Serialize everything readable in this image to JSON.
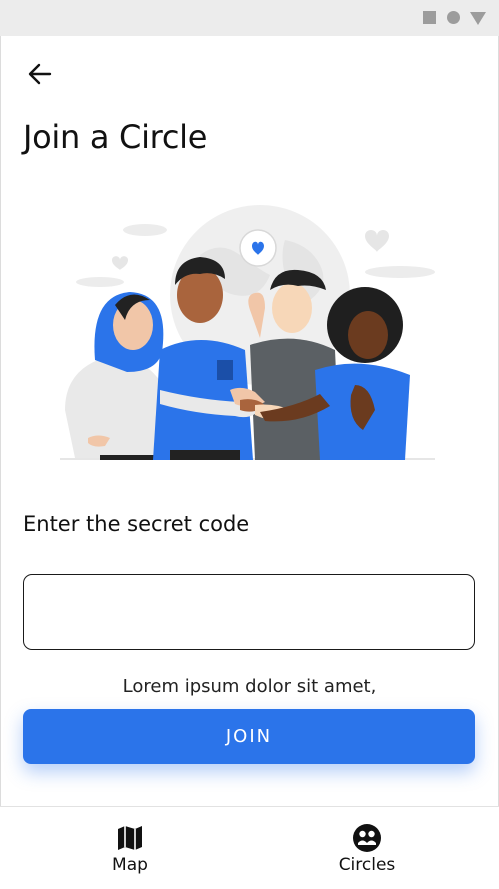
{
  "header": {
    "back_icon": "arrow-left-icon",
    "title": "Join a Circle"
  },
  "illustration": {
    "description_icon": "team-hands-together-illustration",
    "accent_color": "#2b74ea"
  },
  "form": {
    "label": "Enter the secret code",
    "code_value": "",
    "code_placeholder": "",
    "helper_text": "Lorem ipsum dolor sit amet,"
  },
  "actions": {
    "join_label": "JOIN"
  },
  "bottom_nav": {
    "items": [
      {
        "label": "Map",
        "icon": "map-icon"
      },
      {
        "label": "Circles",
        "icon": "circles-icon"
      }
    ]
  },
  "colors": {
    "primary": "#2b74ea",
    "status_bar": "#ececec",
    "text": "#111111"
  }
}
